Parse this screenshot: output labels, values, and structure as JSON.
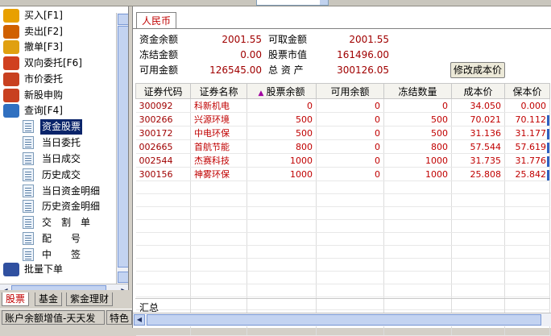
{
  "left_menu": {
    "top_items": [
      {
        "label": "买入[F1]",
        "icon": "buy-icon"
      },
      {
        "label": "卖出[F2]",
        "icon": "sell-icon"
      },
      {
        "label": "撤单[F3]",
        "icon": "cancel-order-icon"
      },
      {
        "label": "双向委托[F6]",
        "icon": "two-way-order-icon"
      },
      {
        "label": "市价委托",
        "icon": "market-order-icon"
      },
      {
        "label": "新股申购",
        "icon": "ipo-subscribe-icon"
      },
      {
        "label": "查询[F4]",
        "icon": "query-icon"
      }
    ],
    "query_children": [
      "资金股票",
      "当日委托",
      "当日成交",
      "历史成交",
      "当日资金明细",
      "历史资金明细",
      "交　割　单",
      "配　　号",
      "中　　签"
    ],
    "selected_child": "资金股票",
    "bottom_item": {
      "label": "批量下单",
      "icon": "batch-order-icon"
    }
  },
  "bottom_tabs": [
    "股票",
    "基金",
    "紫金理财"
  ],
  "active_bottom_tab": "股票",
  "status_bar": [
    "账户余额增值-天天发",
    "特色"
  ],
  "currency_tab": "人民币",
  "summary_info": {
    "fund_balance_label": "资金余额",
    "fund_balance": "2001.55",
    "withdrawable_label": "可取金额",
    "withdrawable": "2001.55",
    "frozen_label": "冻结金额",
    "frozen": "0.00",
    "stock_value_label": "股票市值",
    "stock_value": "161496.00",
    "available_label": "可用金额",
    "available": "126545.00",
    "total_assets_label": "总 资 产",
    "total_assets": "300126.05"
  },
  "modify_cost_button": "修改成本价",
  "table": {
    "columns": [
      "证券代码",
      "证券名称",
      "股票余额",
      "可用余额",
      "冻结数量",
      "成本价",
      "保本价"
    ],
    "rows": [
      [
        "300092",
        "科新机电",
        "0",
        "0",
        "0",
        "34.050",
        "0.000"
      ],
      [
        "300266",
        "兴源环境",
        "500",
        "0",
        "500",
        "70.021",
        "70.112"
      ],
      [
        "300172",
        "中电环保",
        "500",
        "0",
        "500",
        "31.136",
        "31.177"
      ],
      [
        "002665",
        "首航节能",
        "800",
        "0",
        "800",
        "57.544",
        "57.619"
      ],
      [
        "002544",
        "杰赛科技",
        "1000",
        "0",
        "1000",
        "31.735",
        "31.776"
      ],
      [
        "300156",
        "神雾环保",
        "1000",
        "0",
        "1000",
        "25.808",
        "25.842"
      ]
    ],
    "summary_label": "汇总"
  }
}
